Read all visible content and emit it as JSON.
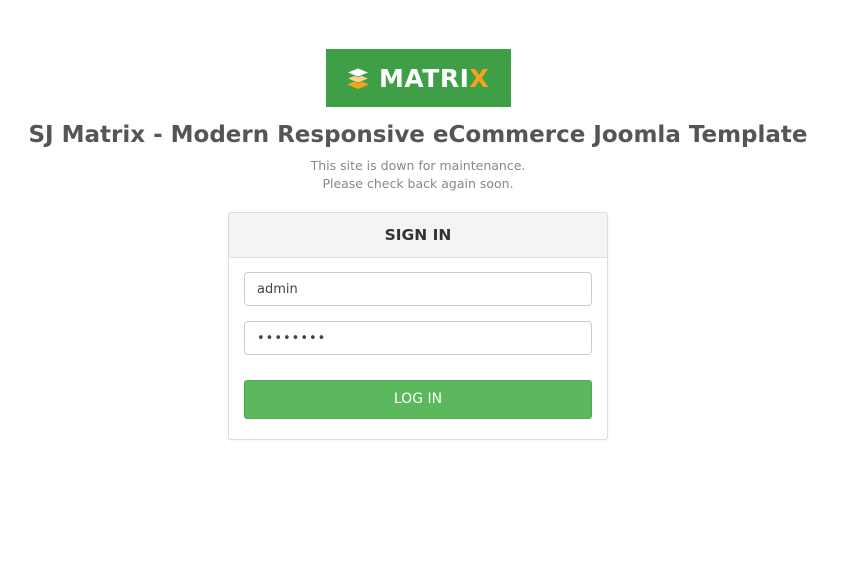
{
  "logo": {
    "text_main": "MATRI",
    "text_accent": "X",
    "icon": "layers-icon",
    "background_color": "#3f9f47",
    "accent_color": "#f7a21a"
  },
  "site_title": "SJ Matrix - Modern Responsive eCommerce Joomla Template",
  "maintenance": {
    "line1": "This site is down for maintenance.",
    "line2": "Please check back again soon."
  },
  "login": {
    "heading": "SIGN IN",
    "username_value": "admin",
    "password_value": "••••••••",
    "button_label": "LOG IN",
    "button_color": "#5cb85c"
  }
}
